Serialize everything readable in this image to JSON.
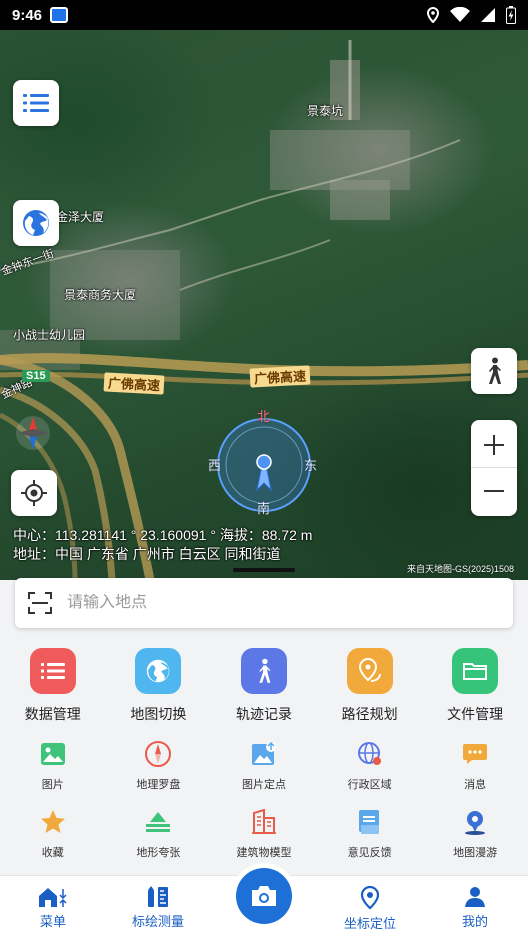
{
  "status": {
    "time": "9:46"
  },
  "map": {
    "labels": {
      "jingtaikeng": "景泰坑",
      "jinze": "金泽大厦",
      "jingtai_business": "景泰商务大厦",
      "kindergarten": "小战士幼儿园",
      "jinshen": "金钟东一街",
      "jinshen2": "金神路"
    },
    "road_badge": "S15",
    "road_names": [
      "广佛高速",
      "广佛高速"
    ],
    "compass_letters": {
      "north": "北",
      "west": "西",
      "east": "东",
      "south": "南"
    },
    "center_text": "中心：113.281141 ° 23.160091 ° 海拔：88.72 m",
    "address_text": "地址：中国 广东省 广州市 白云区 同和街道",
    "attribution": "来自天地图-GS(2025)1508"
  },
  "search": {
    "placeholder": "请输入地点"
  },
  "features_main": [
    {
      "label": "数据管理",
      "icon": "list-icon",
      "color": "#ef5b5b"
    },
    {
      "label": "地图切换",
      "icon": "globe-icon",
      "color": "#4fb6ef"
    },
    {
      "label": "轨迹记录",
      "icon": "walker-icon",
      "color": "#5b78e6"
    },
    {
      "label": "路径规划",
      "icon": "route-pin-icon",
      "color": "#f2a93b"
    },
    {
      "label": "文件管理",
      "icon": "folder-icon",
      "color": "#36c47a"
    }
  ],
  "features_row2": [
    {
      "label": "图片",
      "icon": "picture-icon"
    },
    {
      "label": "地理罗盘",
      "icon": "compass-icon"
    },
    {
      "label": "图片定点",
      "icon": "photo-pin-icon"
    },
    {
      "label": "行政区域",
      "icon": "region-globe-icon"
    },
    {
      "label": "消息",
      "icon": "message-icon"
    }
  ],
  "features_row3": [
    {
      "label": "收藏",
      "icon": "star-icon"
    },
    {
      "label": "地形夸张",
      "icon": "terrain-icon"
    },
    {
      "label": "建筑物模型",
      "icon": "building-icon"
    },
    {
      "label": "意见反馈",
      "icon": "feedback-icon"
    },
    {
      "label": "地图漫游",
      "icon": "roam-pin-icon"
    }
  ],
  "nav": {
    "menu": "菜单",
    "measure": "标绘测量",
    "locate": "坐标定位",
    "mine": "我的"
  },
  "colors": {
    "accent": "#1e6fd6",
    "nav_text": "#1a5fc4"
  }
}
